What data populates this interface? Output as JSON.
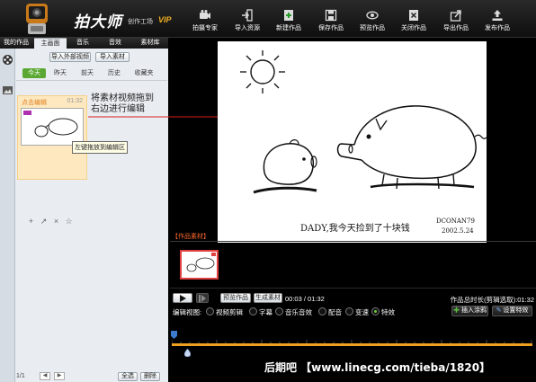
{
  "app": {
    "title": "拍大师",
    "subtitle": "创作工场",
    "vip": "VIP"
  },
  "toolbar": {
    "items": [
      {
        "label": "拍摄专家",
        "icon": "camera-icon"
      },
      {
        "label": "导入资源",
        "icon": "import-icon"
      },
      {
        "label": "新建作品",
        "icon": "new-doc-icon"
      },
      {
        "label": "保存作品",
        "icon": "save-icon"
      },
      {
        "label": "预览作品",
        "icon": "eye-icon"
      },
      {
        "label": "关闭作品",
        "icon": "close-doc-icon"
      },
      {
        "label": "导出作品",
        "icon": "export-icon"
      },
      {
        "label": "发布作品",
        "icon": "upload-icon"
      }
    ]
  },
  "left": {
    "tabs": [
      "我的作品",
      "主画面",
      "音乐",
      "音效",
      "素材库"
    ],
    "active_tab": "主画面",
    "import_video_label": "导入外部视频",
    "import_material_label": "导入素材",
    "date_tabs": [
      "今天",
      "昨天",
      "前天",
      "历史",
      "收藏夹"
    ],
    "active_date": "今天",
    "item": {
      "label": "点击编辑",
      "time": "01:32",
      "tooltip": "左键拖放到编辑区"
    },
    "item_actions": [
      "+",
      "↗",
      "×",
      "☆"
    ],
    "pager": "1/1",
    "pager_prev": "◀",
    "pager_next": "▶",
    "select_all_label": "全选",
    "delete_label": "删除"
  },
  "hint": {
    "line1": "将素材视频拖到",
    "line2": "右边进行编辑"
  },
  "preview": {
    "caption": "DADY,我今天捡到了十块钱",
    "signature": "DCONAN79",
    "signature_date": "2002.5.24"
  },
  "materials": {
    "label": "【作品素材】"
  },
  "controls": {
    "play_icon": "play-icon",
    "preview_label": "预览作品",
    "generate_label": "生成素材",
    "time_current": "00:03",
    "time_total": "01:32",
    "time_sep": " / ",
    "total_label": "作品总时长(剪辑选取):01:32"
  },
  "edit_view": {
    "label": "编辑视图:",
    "options": [
      "视频剪辑",
      "字幕",
      "音乐音效",
      "配音",
      "变速",
      "特效"
    ],
    "selected": "特效",
    "insert_label": "插入涂鸦",
    "settings_label": "设置特效"
  },
  "timeline": {
    "watermark": "后期吧 【www.linecg.com/tieba/1820】"
  },
  "colors": {
    "accent_green": "#5aa832",
    "timeline_orange": "#f0a020",
    "material_red": "#e04040"
  }
}
